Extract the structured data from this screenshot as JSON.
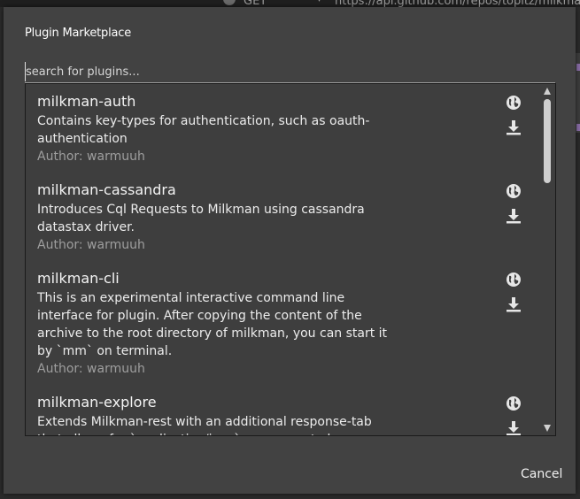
{
  "background": {
    "method": "GET",
    "url": "https://api.github.com/repos/topitz/milkman-theme"
  },
  "dialog": {
    "title": "Plugin Marketplace",
    "search": {
      "placeholder": "search for plugins...",
      "value": ""
    },
    "plugins": [
      {
        "name": "milkman-auth",
        "description": "Contains key-types for authentication, such as oauth-authentication",
        "author": "Author: warmuuh"
      },
      {
        "name": "milkman-cassandra",
        "description": "Introduces Cql Requests to Milkman using cassandra datastax driver.",
        "author": "Author: warmuuh"
      },
      {
        "name": "milkman-cli",
        "description": "This is an experimental interactive command line interface for plugin. After copying the content of the archive to the root directory of milkman, you can start it by `mm` on terminal.",
        "author": "Author: warmuuh"
      },
      {
        "name": "milkman-explore",
        "description": "Extends Milkman-rest with an additional response-tab that allows for `application/json` responses to be explored using",
        "author": ""
      }
    ],
    "icons": {
      "globe": "globe-icon",
      "download": "download-icon"
    },
    "cancel_label": "Cancel"
  },
  "colors": {
    "dialog_bg": "#424242",
    "list_bg": "#3e3e3e",
    "author_text": "#9e9e9e",
    "accent_purple": "#8b6ea8"
  }
}
